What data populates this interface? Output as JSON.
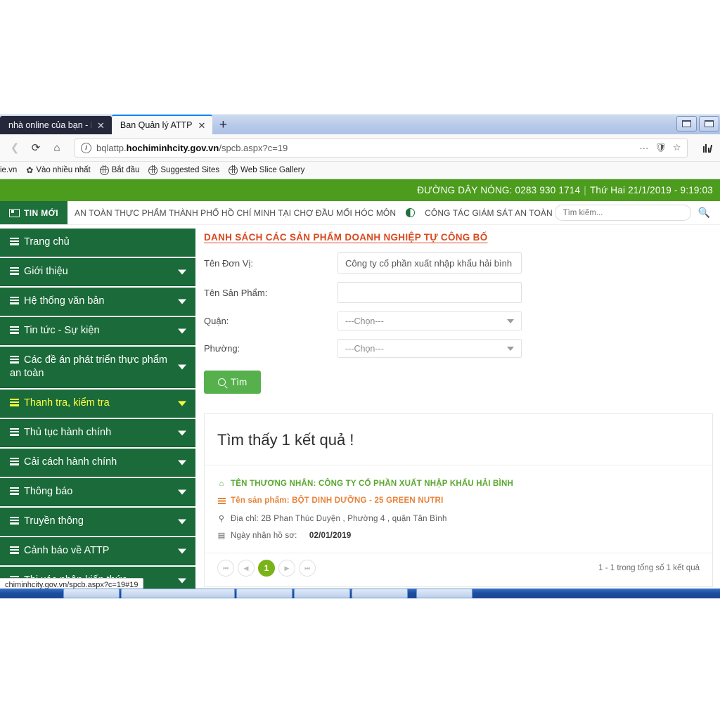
{
  "browser": {
    "tabs": [
      {
        "title": "nhà online của bạn - Hom",
        "active": false
      },
      {
        "title": "Ban Quản lý ATTP",
        "active": true
      }
    ],
    "new_tab_label": "+",
    "close_glyph": "✕",
    "url_prefix": "bqlattp.",
    "url_domain": "hochiminhcity.gov.vn",
    "url_path": "/spcb.aspx?c=19",
    "bookmarks": [
      {
        "label": "ie.vn",
        "icon": "none"
      },
      {
        "label": "Vào nhiều nhất",
        "icon": "gear-icon"
      },
      {
        "label": "Bắt đầu",
        "icon": "globe-icon"
      },
      {
        "label": "Suggested Sites",
        "icon": "globe-icon"
      },
      {
        "label": "Web Slice Gallery",
        "icon": "globe-icon"
      }
    ],
    "status_bubble": "chiminhcity.gov.vn/spcb.aspx?c=19#19"
  },
  "site": {
    "hotline_label": "ĐƯỜNG DÂY NÓNG:",
    "hotline_number": "0283 930 1714",
    "datetime": "Thứ Hai 21/1/2019 - 9:19:03",
    "news_badge": "TIN MỚI",
    "ticker_item_1": "AN TOÀN THỰC PHẨM THÀNH PHỐ HỒ CHÍ MINH TẠI CHỢ ĐẦU MỐI HÓC MÔN",
    "ticker_item_2": "CÔNG TÁC GIÁM SÁT AN TOÀN THỰC PHẨM TẾT K",
    "search_placeholder": "Tìm kiếm...",
    "search_value": "",
    "accent_green": "#4c9c1d",
    "sidebar_green": "#1a6b39",
    "active_yellow": "#ffff3f"
  },
  "sidebar": {
    "items": [
      {
        "label": "Trang chủ",
        "caret": false,
        "active": false
      },
      {
        "label": "Giới thiệu",
        "caret": true,
        "active": false
      },
      {
        "label": "Hệ thống văn bản",
        "caret": true,
        "active": false
      },
      {
        "label": "Tin tức - Sự kiện",
        "caret": true,
        "active": false
      },
      {
        "label": "Các đề án phát triển thực phẩm an toàn",
        "caret": true,
        "active": false
      },
      {
        "label": "Thanh tra, kiểm tra",
        "caret": true,
        "active": true
      },
      {
        "label": "Thủ tục hành chính",
        "caret": true,
        "active": false
      },
      {
        "label": "Cải cách hành chính",
        "caret": true,
        "active": false
      },
      {
        "label": "Thông báo",
        "caret": true,
        "active": false
      },
      {
        "label": "Truyền thông",
        "caret": true,
        "active": false
      },
      {
        "label": "Cảnh báo về ATTP",
        "caret": true,
        "active": false
      },
      {
        "label": "Thi xác nhận kiến thức",
        "caret": true,
        "active": false
      },
      {
        "label": "",
        "caret": true,
        "active": false
      }
    ]
  },
  "main": {
    "page_title": "DANH SÁCH CÁC SẢN PHẨM DOANH NGHIỆP TỰ CÔNG BỐ",
    "form": {
      "unit_label": "Tên Đơn Vị:",
      "unit_value": "Công ty cổ phần xuất nhập khẩu hải bình",
      "unit_placeholder": "",
      "product_label": "Tên Sản Phẩm:",
      "product_value": "",
      "product_placeholder": "",
      "district_label": "Quận:",
      "district_value": "---Chọn---",
      "ward_label": "Phường:",
      "ward_value": "---Chọn---",
      "submit_label": "Tìm"
    },
    "results": {
      "heading": "Tìm thấy 1 kết quả !",
      "items": [
        {
          "merchant": "TÊN THƯƠNG NHÂN: CÔNG TY CỔ PHẦN XUẤT NHẬP KHẨU HẢI BÌNH",
          "product": "Tên sản phẩm: BỘT DINH DƯỠNG - 25 GREEN NUTRI",
          "address": "Địa chỉ: 2B Phan Thúc Duyện , Phường 4 , quận Tân Bình",
          "received_label": "Ngày nhận hồ sơ:",
          "received_date": "02/01/2019"
        }
      ],
      "pagination": {
        "first": "⏮",
        "prev": "◀",
        "current": "1",
        "next": "▶",
        "last": "⏭",
        "summary": "1 - 1 trong tổng số 1 kết quả"
      }
    }
  }
}
